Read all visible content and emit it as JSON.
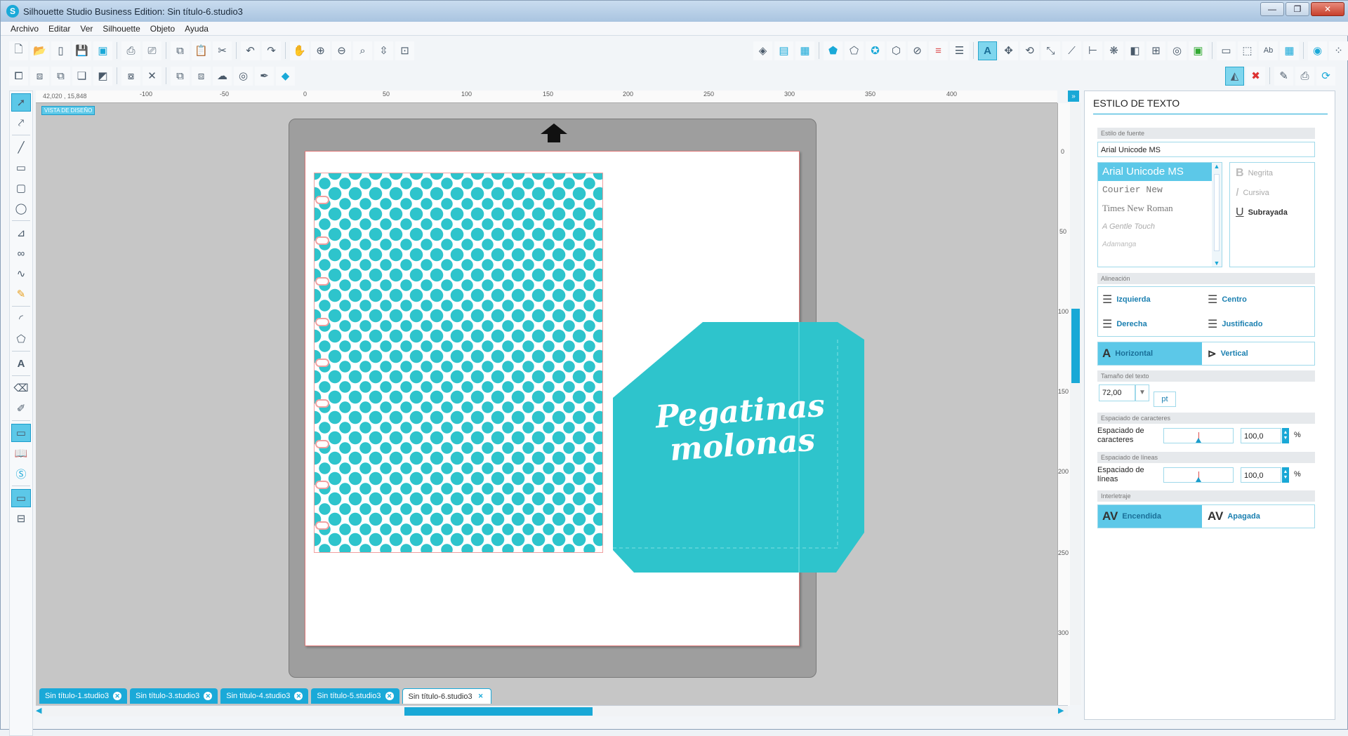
{
  "app": {
    "title": "Silhouette Studio Business Edition: Sin título-6.studio3"
  },
  "menu": [
    "Archivo",
    "Editar",
    "Ver",
    "Silhouette",
    "Objeto",
    "Ayuda"
  ],
  "canvas": {
    "coords": "42,020 , 15,848",
    "view_label": "VISTA DE DISEÑO",
    "hruler_ticks": [
      "-100",
      "-50",
      "0",
      "50",
      "100",
      "150",
      "200",
      "250",
      "300",
      "350",
      "400"
    ],
    "vruler_ticks": [
      "0",
      "50",
      "100",
      "150",
      "200",
      "250",
      "300"
    ],
    "label_text_line1": "Pegatinas",
    "label_text_line2": "molonas",
    "pattern_color": "#2ec4cc"
  },
  "tabs": [
    {
      "label": "Sin título-1.studio3"
    },
    {
      "label": "Sin título-3.studio3"
    },
    {
      "label": "Sin título-4.studio3"
    },
    {
      "label": "Sin título-5.studio3"
    },
    {
      "label": "Sin título-6.studio3"
    }
  ],
  "panel": {
    "title": "ESTILO DE TEXTO",
    "font_section": "Estilo de fuente",
    "font_value": "Arial Unicode MS",
    "fonts": [
      "Arial Unicode MS",
      "Courier New",
      "Times New Roman",
      "A Gentle Touch",
      "Adamanga"
    ],
    "style_bold": "Negrita",
    "style_italic": "Cursiva",
    "style_underline": "Subrayada",
    "align_section": "Alineación",
    "align_left": "Izquierda",
    "align_center": "Centro",
    "align_right": "Derecha",
    "align_justify": "Justificado",
    "dir_horizontal": "Horizontal",
    "dir_vertical": "Vertical",
    "size_section": "Tamaño del texto",
    "size_value": "72,00",
    "size_unit": "pt",
    "char_section": "Espaciado de caracteres",
    "char_label": "Espaciado de caracteres",
    "char_value": "100,0",
    "line_section": "Espaciado de líneas",
    "line_label": "Espaciado de líneas",
    "line_value": "100,0",
    "percent": "%",
    "kern_section": "Interletraje",
    "kern_on": "Encendida",
    "kern_off": "Apagada",
    "kern_icon_text": "AV"
  },
  "colors": {
    "accent": "#19a8d6",
    "mat": "#9e9e9e",
    "label_fill": "#2ec4cc"
  }
}
